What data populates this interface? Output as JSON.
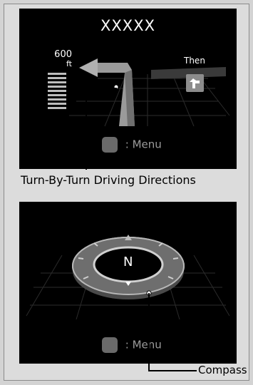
{
  "turn_by_turn": {
    "street_name": "XXXXX",
    "distance_value": "600",
    "distance_unit": "ft",
    "next_label": "Then",
    "menu_label": ": Menu",
    "caption": "Turn-By-Turn Driving Directions"
  },
  "compass": {
    "heading_letter": "N",
    "menu_label": ": Menu",
    "caption": "Compass"
  },
  "colors": {
    "screen_bg": "#000000",
    "route_arrow": "#9a9a9a",
    "ui_grey": "#8c8c8c"
  }
}
